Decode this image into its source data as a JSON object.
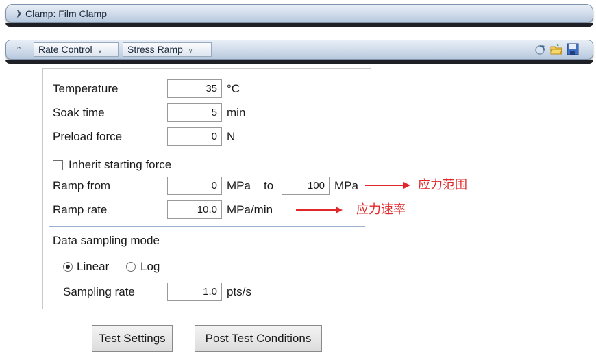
{
  "clamp_bar": {
    "title": "Clamp: Film Clamp"
  },
  "procedure_bar": {
    "mode": "Rate Control",
    "test": "Stress Ramp"
  },
  "panel": {
    "temperature": {
      "label": "Temperature",
      "value": "35",
      "unit": "°C"
    },
    "soak_time": {
      "label": "Soak time",
      "value": "5",
      "unit": "min"
    },
    "preload_force": {
      "label": "Preload force",
      "value": "0",
      "unit": "N"
    },
    "inherit_force": {
      "label": "Inherit starting force",
      "checked": false
    },
    "ramp_from": {
      "label": "Ramp from",
      "value": "0",
      "unit": "MPa",
      "to_label": "to",
      "to_value": "100",
      "to_unit": "MPa"
    },
    "ramp_rate": {
      "label": "Ramp rate",
      "value": "10.0",
      "unit": "MPa/min"
    },
    "sampling_mode": {
      "label": "Data sampling mode",
      "linear": "Linear",
      "log": "Log",
      "selected": "Linear"
    },
    "sampling_rate": {
      "label": "Sampling rate",
      "value": "1.0",
      "unit": "pts/s"
    }
  },
  "buttons": {
    "test_settings": "Test Settings",
    "post_test": "Post Test Conditions"
  },
  "annotations": {
    "range": "应力范围",
    "rate": "应力速率"
  },
  "colors": {
    "annotation": "#e0282a",
    "bar": "#cfdbea"
  }
}
